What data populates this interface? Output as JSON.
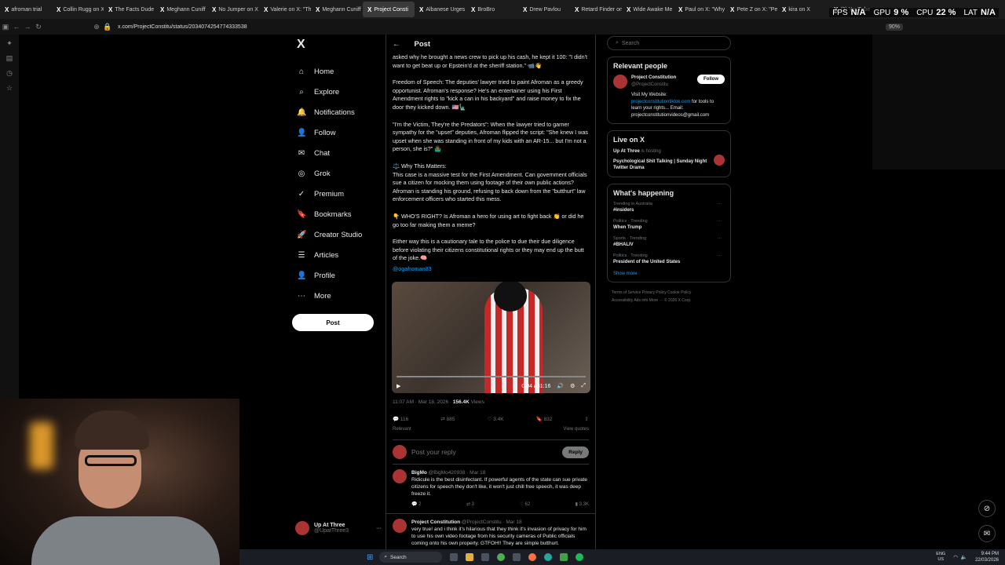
{
  "tabs": [
    {
      "label": "afroman trial",
      "active": false
    },
    {
      "label": "Collin Rugg on X",
      "active": false
    },
    {
      "label": "The Facts Dude",
      "active": false
    },
    {
      "label": "Meghann Cuniff",
      "active": false
    },
    {
      "label": "No Jumper on X",
      "active": false
    },
    {
      "label": "Valerie on X: \"Th",
      "active": false
    },
    {
      "label": "Meghann Cuniff",
      "active": false
    },
    {
      "label": "Project Consti",
      "active": true
    },
    {
      "label": "Albanese Urges",
      "active": false
    },
    {
      "label": "BroBro",
      "active": false
    },
    {
      "label": "Drew Pavlou",
      "active": false
    },
    {
      "label": "Retard Finder on",
      "active": false
    },
    {
      "label": "Wide Awake Me",
      "active": false
    },
    {
      "label": "Paul on X: \"Why",
      "active": false
    },
    {
      "label": "Pete Z on X: \"Pe",
      "active": false
    },
    {
      "label": "kira on X",
      "active": false
    },
    {
      "label": "(3) YouTube",
      "active": false
    }
  ],
  "overlay": {
    "fps_label": "FPS",
    "fps": "N/A",
    "gpu_label": "GPU",
    "gpu": "9 %",
    "cpu_label": "CPU",
    "cpu": "22 %",
    "lat_label": "LAT",
    "lat": "N/A"
  },
  "address": {
    "url": "x.com/ProjectConstitu/status/2034074254774333538",
    "zoom": "90%"
  },
  "xnav": {
    "logo": "X",
    "items": [
      {
        "label": "Home",
        "icon": "⌂"
      },
      {
        "label": "Explore",
        "icon": "⌕"
      },
      {
        "label": "Notifications",
        "icon": "🔔"
      },
      {
        "label": "Follow",
        "icon": "👤"
      },
      {
        "label": "Chat",
        "icon": "✉"
      },
      {
        "label": "Grok",
        "icon": "◎"
      },
      {
        "label": "Premium",
        "icon": "✓"
      },
      {
        "label": "Bookmarks",
        "icon": "🔖"
      },
      {
        "label": "Creator Studio",
        "icon": "🚀"
      },
      {
        "label": "Articles",
        "icon": "☰"
      },
      {
        "label": "Profile",
        "icon": "👤"
      },
      {
        "label": "More",
        "icon": "⋯"
      }
    ],
    "post_button": "Post"
  },
  "user": {
    "name": "Up At Three",
    "handle": "@UpatThree3"
  },
  "post": {
    "header": "Post",
    "paragraphs": [
      "asked why he brought a news crew to pick up his cash, he kept it 100: \"I didn't want to get beat up or Epstein'd at the sheriff station.\" 📹👋",
      "Freedom of Speech: The deputies' lawyer tried to paint Afroman as a greedy opportunist. Afroman's response? He's an entertainer using his First Amendment rights to \"kick a can in his backyard\" and raise money to fix the door they kicked down. 🇺🇸🗽",
      "\"I'm the Victim, They're the Predators\": When the lawyer tried to garner sympathy for the \"upset\" deputies, Afroman flipped the script: \"She knew I was upset when she was standing in front of my kids with an AR-15... but I'm not a person, she is?\" 🤷🏾‍♂️",
      "⚖️ Why This Matters:\nThis case is a massive test for the First Amendment. Can government officials sue a citizen for mocking them using footage of their own public actions? Afroman is standing his ground, refusing to back down from the \"butthurt\" law enforcement officers who started this mess.",
      "👇 WHO'S RIGHT? Is Afroman a hero for using art to fight back 👏 or did he go too far making them a meme?",
      "Either way this is a cautionary tale to the police to due their due diligence before violating their citizens constitutional rights or they may end up the butt of the joke.🧠"
    ],
    "mention": "@ogafroman83",
    "video_time": "0:04 / 31:16",
    "time": "11:07 AM · Mar 18, 2026 · ",
    "views_num": "156.4K",
    "views_label": "Views",
    "replies": "116",
    "reposts": "885",
    "likes": "3.4K",
    "bookmarks": "832",
    "relevant": "Relevant",
    "view_quotes": "View quotes",
    "reply_placeholder": "Post your reply",
    "reply_button": "Reply"
  },
  "replies": [
    {
      "name": "BigMo",
      "handle": "@BigMo420938 · Mar 18",
      "text": "Ridicule is the best disinfectant. If powerful agents of the state can sue private citizens for speech they don't like, it won't just chill free speech, it was deep freeze it.",
      "r": "2",
      "rt": "3",
      "l": "62",
      "v": "3.3K"
    },
    {
      "name": "Project Constitution",
      "handle": "@ProjectConstitu · Mar 18",
      "text": "very true! and i think it's hilarious that they think it's invasion of privacy for him to use his own video footage from his security cameras of Public officials coming onto his own property. GTFOH!! They are simple butthurt.",
      "r": "",
      "rt": "",
      "l": "",
      "v": ""
    }
  ],
  "right": {
    "search_placeholder": "Search",
    "relevant_title": "Relevant people",
    "person_name": "Project Constitution",
    "person_handle": "@ProjectConstitu",
    "follow": "Follow",
    "bio_1": "Visit My Website: ",
    "bio_link": "projectconstitutiontiktok.com",
    "bio_2": " for tools to learn your rights... Email: projectconstitutionvideos@gmail.com",
    "live_title": "Live on X",
    "live_host": "Up At Three",
    "live_status": "is hosting",
    "live_show": "Psychological Shit Talking | Sunday Night Twitter Drama",
    "happening_title": "What's happening",
    "trends": [
      {
        "context": "Trending in Australia",
        "name": "#insiders"
      },
      {
        "context": "Politics · Trending",
        "name": "When Trump"
      },
      {
        "context": "Sports · Trending",
        "name": "#BHALIV"
      },
      {
        "context": "Politics · Trending",
        "name": "President of the United States"
      }
    ],
    "show_more": "Show more",
    "footer_1": "Terms of Service   Privacy Policy   Cookie Policy",
    "footer_2": "Accessibility   Ads info   More ···   © 2026 X Corp."
  },
  "taskbar": {
    "search": "Search",
    "lang": "ENG\nUS",
    "time": "9:44 PM",
    "date": "22/03/2026"
  }
}
